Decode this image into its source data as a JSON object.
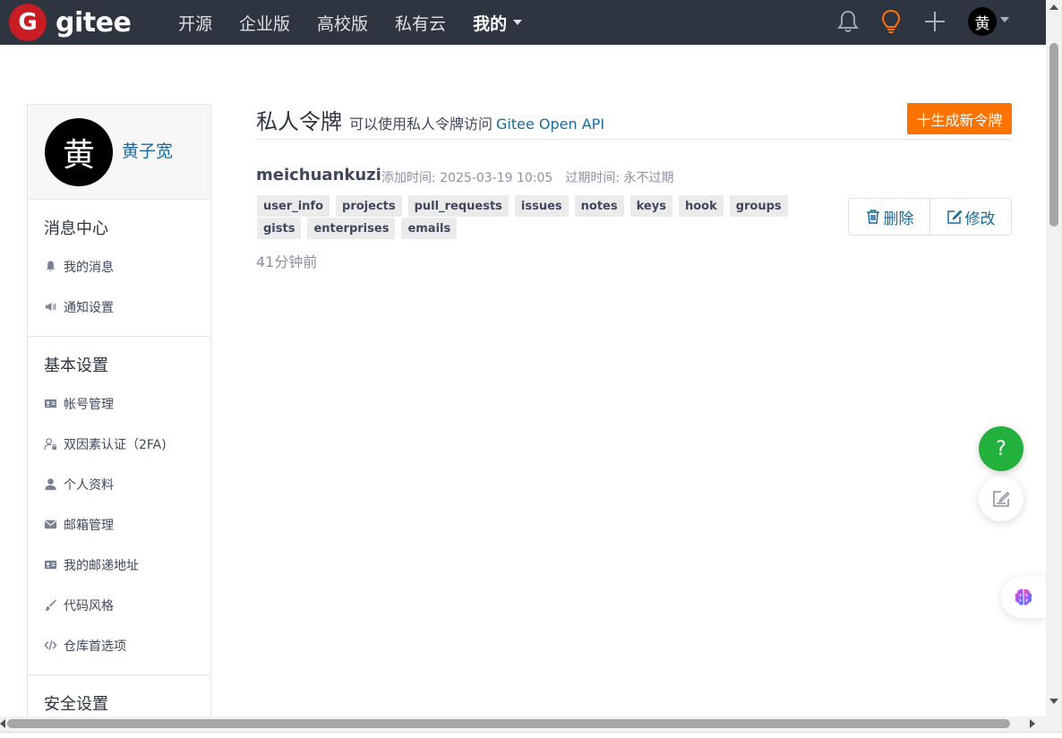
{
  "nav": {
    "logo_letter": "G",
    "logo_text": "gitee",
    "links": [
      "开源",
      "企业版",
      "高校版",
      "私有云",
      "我的"
    ],
    "avatar_char": "黄",
    "icons": [
      "bell-icon",
      "lightbulb-icon",
      "plus-icon"
    ]
  },
  "sidebar": {
    "avatar_char": "黄",
    "user_name": "黄子宽",
    "sections": [
      {
        "title": "消息中心",
        "items": [
          {
            "icon": "bell-icon",
            "label": "我的消息"
          },
          {
            "icon": "speaker-icon",
            "label": "通知设置"
          }
        ]
      },
      {
        "title": "基本设置",
        "items": [
          {
            "icon": "id-card-icon",
            "label": "帐号管理"
          },
          {
            "icon": "user-lock-icon",
            "label": "双因素认证（2FA)"
          },
          {
            "icon": "user-icon",
            "label": "个人资料"
          },
          {
            "icon": "envelope-icon",
            "label": "邮箱管理"
          },
          {
            "icon": "address-card-icon",
            "label": "我的邮递地址"
          },
          {
            "icon": "brush-icon",
            "label": "代码风格"
          },
          {
            "icon": "code-icon",
            "label": "仓库首选项"
          }
        ]
      },
      {
        "title": "安全设置",
        "items": []
      }
    ]
  },
  "main": {
    "title": "私人令牌",
    "subtitle": "可以使用私人令牌访问",
    "api_link": "Gitee Open API",
    "generate_button": "十生成新令牌",
    "token": {
      "name": "meichuankuzi",
      "added": "添加时间: 2025-03-19 10:05",
      "expires": "过期时间: 永不过期",
      "scopes": [
        "user_info",
        "projects",
        "pull_requests",
        "issues",
        "notes",
        "keys",
        "hook",
        "groups",
        "gists",
        "enterprises",
        "emails"
      ],
      "relative_time": "41分钟前",
      "delete_label": "删除",
      "edit_label": "修改"
    }
  },
  "floating": {
    "help_label": "?"
  },
  "colors": {
    "nav_bg": "#2e3440",
    "brand_red": "#c71d23",
    "accent_orange": "#fe7300",
    "link_blue": "#1a6b9c",
    "help_green": "#21b13c"
  }
}
